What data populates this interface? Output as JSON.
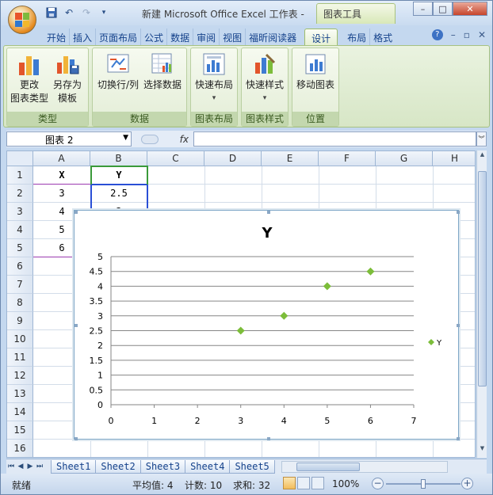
{
  "window": {
    "title": "新建 Microsoft Office Excel 工作表 -",
    "context_tab": "图表工具",
    "controls": {
      "minimize": "–",
      "maximize": "□",
      "close": "✕"
    }
  },
  "ribbon_tabs": [
    {
      "label": "开始"
    },
    {
      "label": "插入"
    },
    {
      "label": "页面布局"
    },
    {
      "label": "公式"
    },
    {
      "label": "数据"
    },
    {
      "label": "审阅"
    },
    {
      "label": "视图"
    },
    {
      "label": "福昕阅读器"
    },
    {
      "label": "设计",
      "active": true
    },
    {
      "label": "布局"
    },
    {
      "label": "格式"
    }
  ],
  "ribbon": {
    "groups": [
      {
        "label": "类型",
        "buttons": [
          {
            "l1": "更改",
            "l2": "图表类型"
          },
          {
            "l1": "另存为",
            "l2": "模板"
          }
        ]
      },
      {
        "label": "数据",
        "buttons": [
          {
            "l1": "切换行/列"
          },
          {
            "l1": "选择数据"
          }
        ]
      },
      {
        "label": "图表布局",
        "buttons": [
          {
            "l1": "快速布局",
            "l2": "▾"
          }
        ]
      },
      {
        "label": "图表样式",
        "buttons": [
          {
            "l1": "快速样式",
            "l2": "▾"
          }
        ]
      },
      {
        "label": "位置",
        "buttons": [
          {
            "l1": "移动图表"
          }
        ]
      }
    ]
  },
  "formula_bar": {
    "name_box": "图表 2",
    "fx": "fx",
    "value": ""
  },
  "grid": {
    "columns": [
      "A",
      "B",
      "C",
      "D",
      "E",
      "F",
      "G",
      "H"
    ],
    "rows": [
      "1",
      "2",
      "3",
      "4",
      "5",
      "6",
      "7",
      "8",
      "9",
      "10",
      "11",
      "12",
      "13",
      "14",
      "15",
      "16"
    ],
    "cells": {
      "A1": "X",
      "B1": "Y",
      "A2": "3",
      "B2": "2.5",
      "A3": "4",
      "B3": "3",
      "A4": "5",
      "A5": "6"
    }
  },
  "chart_data": {
    "type": "scatter",
    "title": "Y",
    "series": [
      {
        "name": "Y",
        "x": [
          3,
          4,
          5,
          6
        ],
        "y": [
          2.5,
          3,
          4,
          4.5
        ],
        "color": "#7cbd3a"
      }
    ],
    "xlim": [
      0,
      7
    ],
    "ylim": [
      0,
      5
    ],
    "xticks": [
      "0",
      "1",
      "2",
      "3",
      "4",
      "5",
      "6",
      "7"
    ],
    "yticks": [
      "0",
      "0.5",
      "1",
      "1.5",
      "2",
      "2.5",
      "3",
      "3.5",
      "4",
      "4.5",
      "5"
    ],
    "grid": true,
    "legend": "right"
  },
  "sheet_tabs": [
    "Sheet1",
    "Sheet2",
    "Sheet3",
    "Sheet4",
    "Sheet5"
  ],
  "status": {
    "ready": "就绪",
    "average": "平均值: 4",
    "count": "计数: 10",
    "sum": "求和: 32",
    "zoom": "100%"
  }
}
